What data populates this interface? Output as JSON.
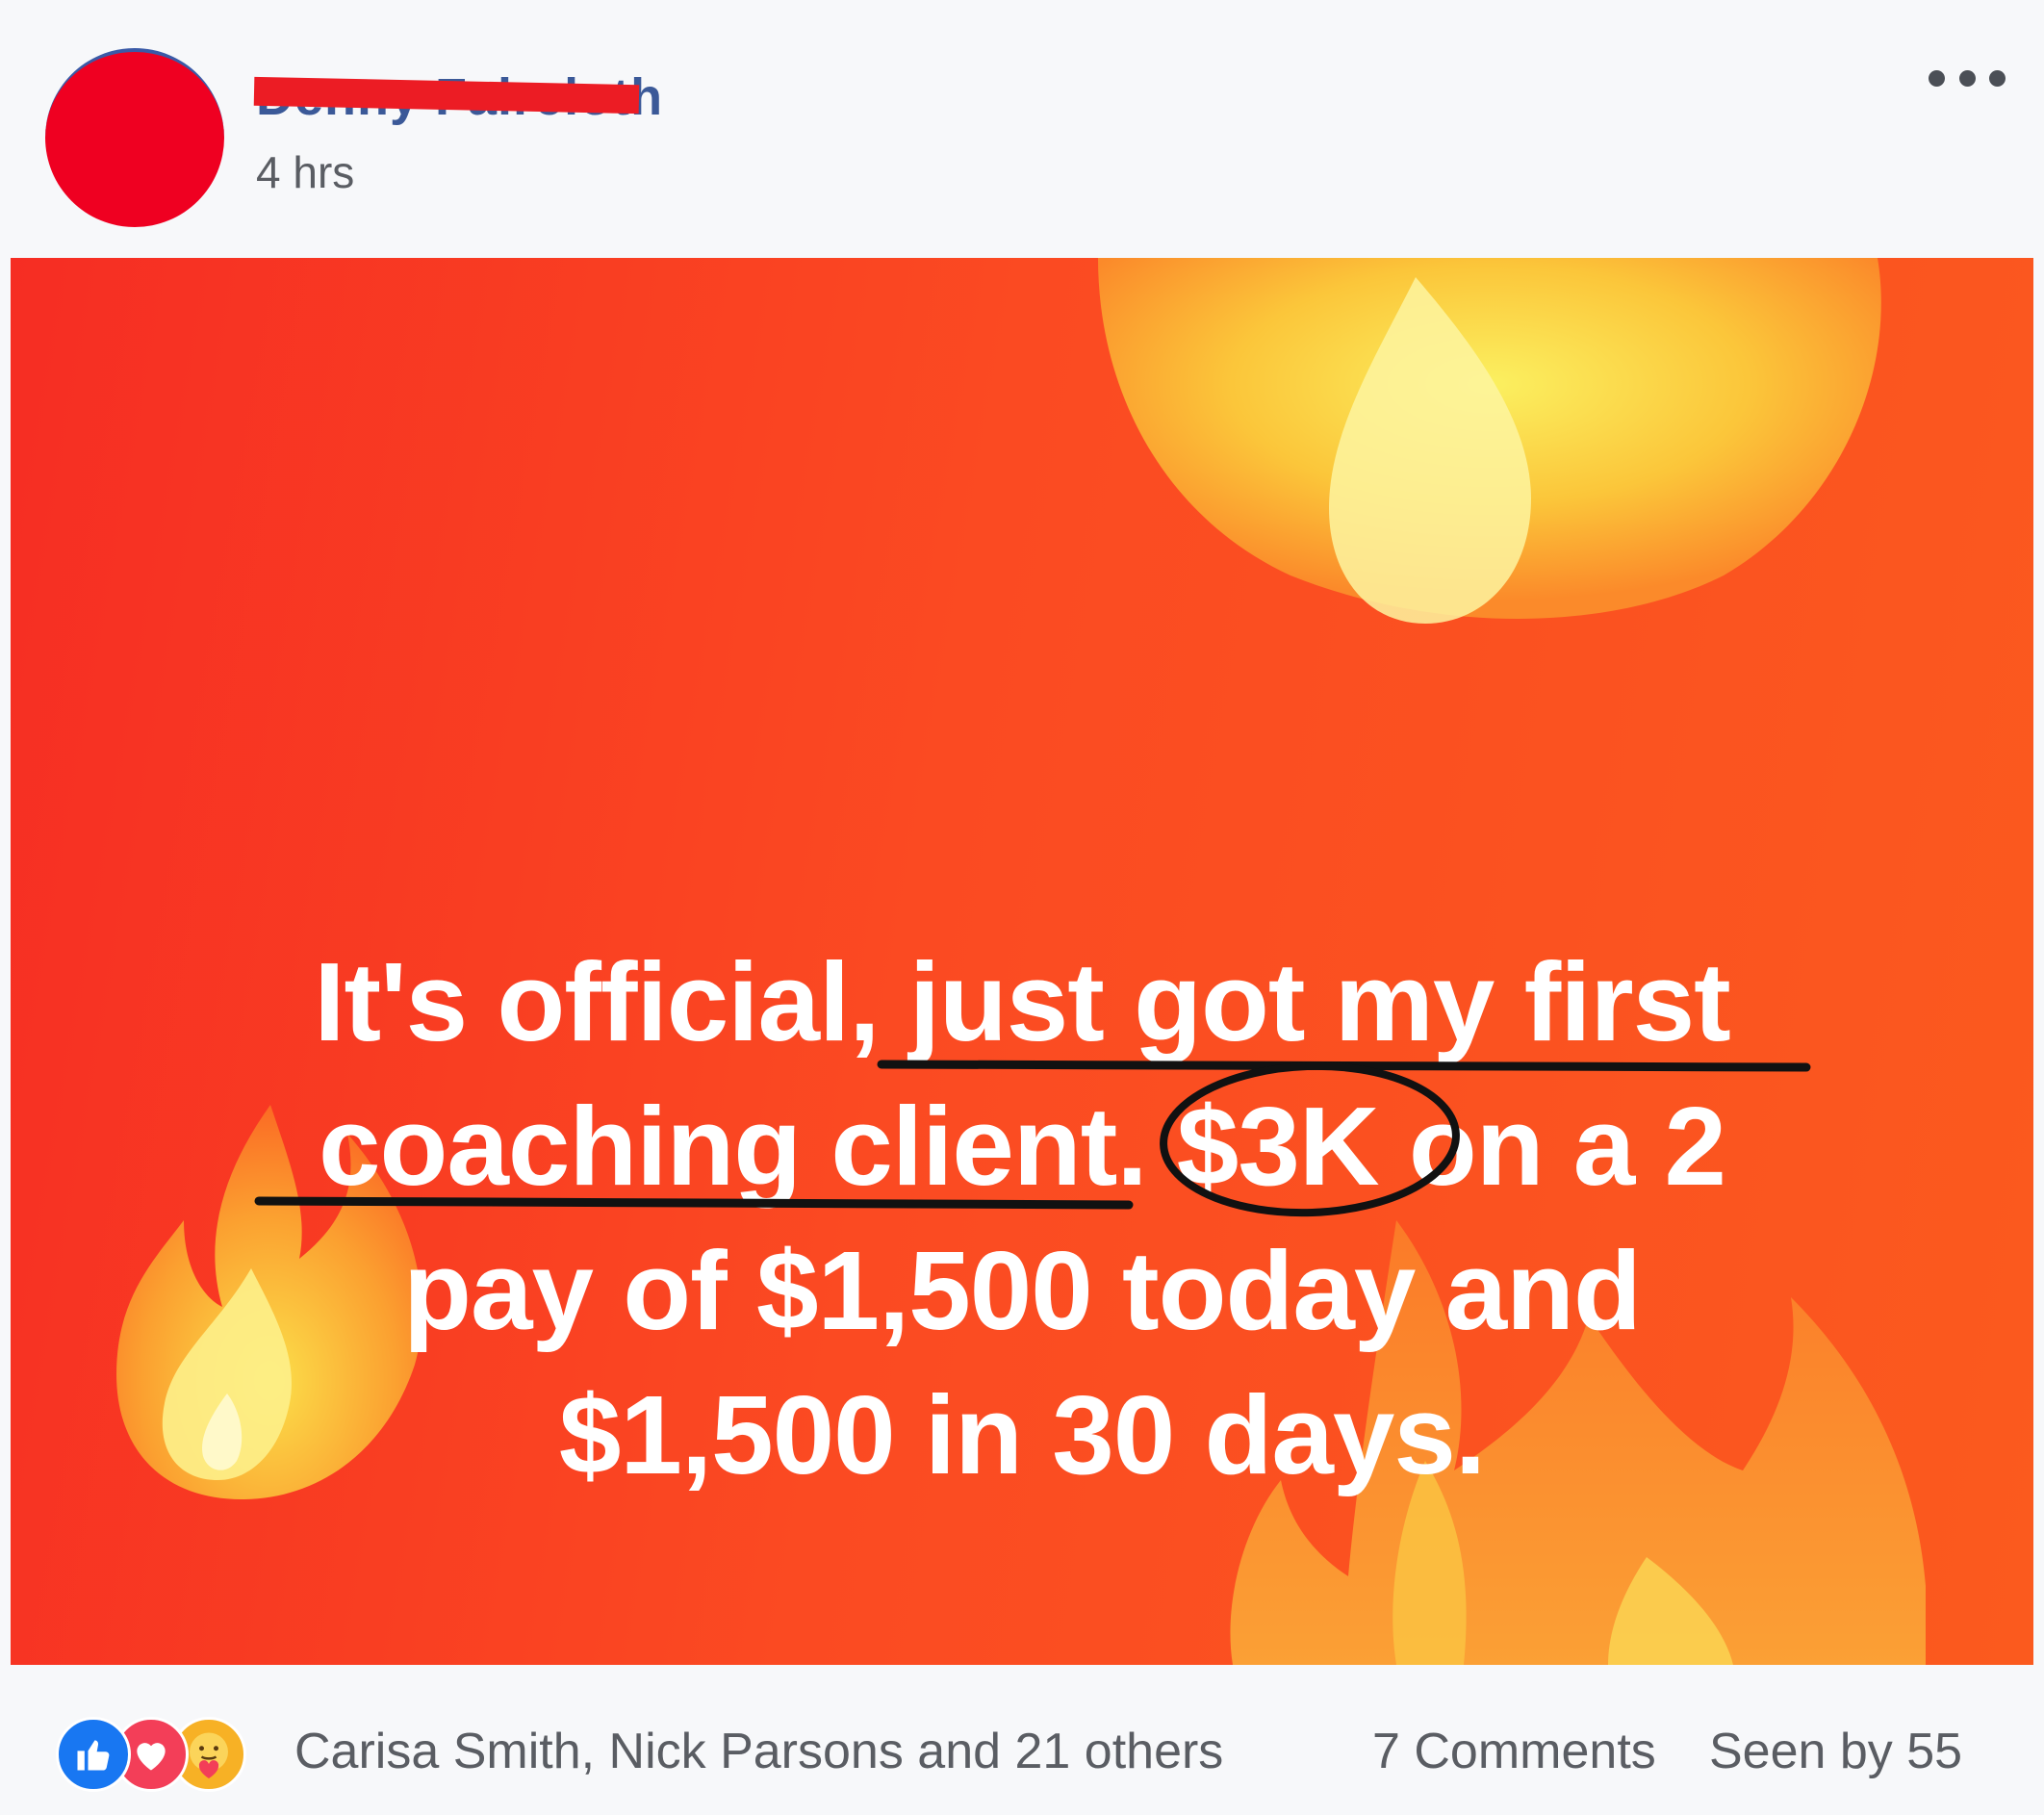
{
  "post": {
    "author_name": "Denny Faircloth",
    "timestamp": "4 hrs",
    "more_icon": "ellipsis-icon"
  },
  "image": {
    "caption_lines": [
      "It's official, just got my first",
      "coaching client. $3K on a 2",
      "pay of $1,500 today and",
      "$1,500 in 30 days."
    ],
    "colors": {
      "background_left": "#f62d23",
      "background_right": "#fb5a1e",
      "flame_yellow": "#fbe34a",
      "flame_orange": "#fb8a2a",
      "annotation": "#111111"
    }
  },
  "footer": {
    "reaction_icons": [
      "like-icon",
      "love-icon",
      "care-icon"
    ],
    "reaction_names": "Carisa Smith, Nick Parsons and 21 others",
    "comments": "7 Comments",
    "seen_by": "Seen by 55"
  }
}
